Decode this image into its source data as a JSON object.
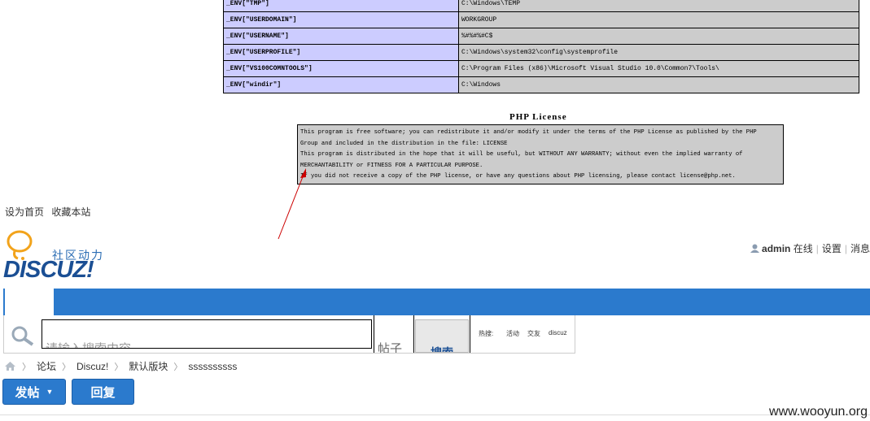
{
  "env_table": {
    "rows": [
      {
        "key": "_ENV[\"TMP\"]",
        "value": "C:\\Windows\\TEMP"
      },
      {
        "key": "_ENV[\"USERDOMAIN\"]",
        "value": "WORKGROUP"
      },
      {
        "key": "_ENV[\"USERNAME\"]",
        "value": "%#%#%#C$"
      },
      {
        "key": "_ENV[\"USERPROFILE\"]",
        "value": "C:\\Windows\\system32\\config\\systemprofile"
      },
      {
        "key": "_ENV[\"VS100COMNTOOLS\"]",
        "value": "C:\\Program Files (x86)\\Microsoft Visual Studio 10.0\\Common7\\Tools\\"
      },
      {
        "key": "_ENV[\"windir\"]",
        "value": "C:\\Windows"
      }
    ]
  },
  "license": {
    "title": "PHP License",
    "lines": [
      "This program is free software; you can redistribute it and/or modify it under the terms of the PHP License as published by the PHP",
      "Group and included in the distribution in the file: LICENSE",
      "This program is distributed in the hope that it will be useful, but WITHOUT ANY WARRANTY; without even the implied warranty of",
      "MERCHANTABILITY or FITNESS FOR A PARTICULAR PURPOSE.",
      "If you did not receive a copy of the PHP license, or have any questions about PHP licensing, please contact license@php.net."
    ]
  },
  "top_links": {
    "set_home": "设为首页",
    "bookmark": "收藏本站"
  },
  "logo": {
    "slogan": "社区动力",
    "word": "DISCUZ!"
  },
  "user": {
    "name": "admin",
    "status": "在线",
    "settings": "设置",
    "messages": "消息"
  },
  "search": {
    "placeholder": "请输入搜索内容",
    "type": "帖子",
    "button": "搜索",
    "hot_label": "热搜:",
    "hot_tags": [
      "活动",
      "交友",
      "discuz"
    ]
  },
  "breadcrumb": {
    "items": [
      "论坛",
      "Discuz!",
      "默认版块",
      "ssssssssss"
    ]
  },
  "actions": {
    "post": "发帖",
    "reply": "回复"
  },
  "watermark": "www.wooyun.org",
  "colors": {
    "nav_blue": "#2b7acd",
    "env_key_bg": "#ccccff",
    "env_value_bg": "#cccccc",
    "annotation_arrow": "#cc0000"
  },
  "icons": {
    "home": "home-icon",
    "search": "search-icon",
    "user": "user-icon",
    "caret": "caret-down-icon",
    "logo": "lightbulb-icon"
  }
}
